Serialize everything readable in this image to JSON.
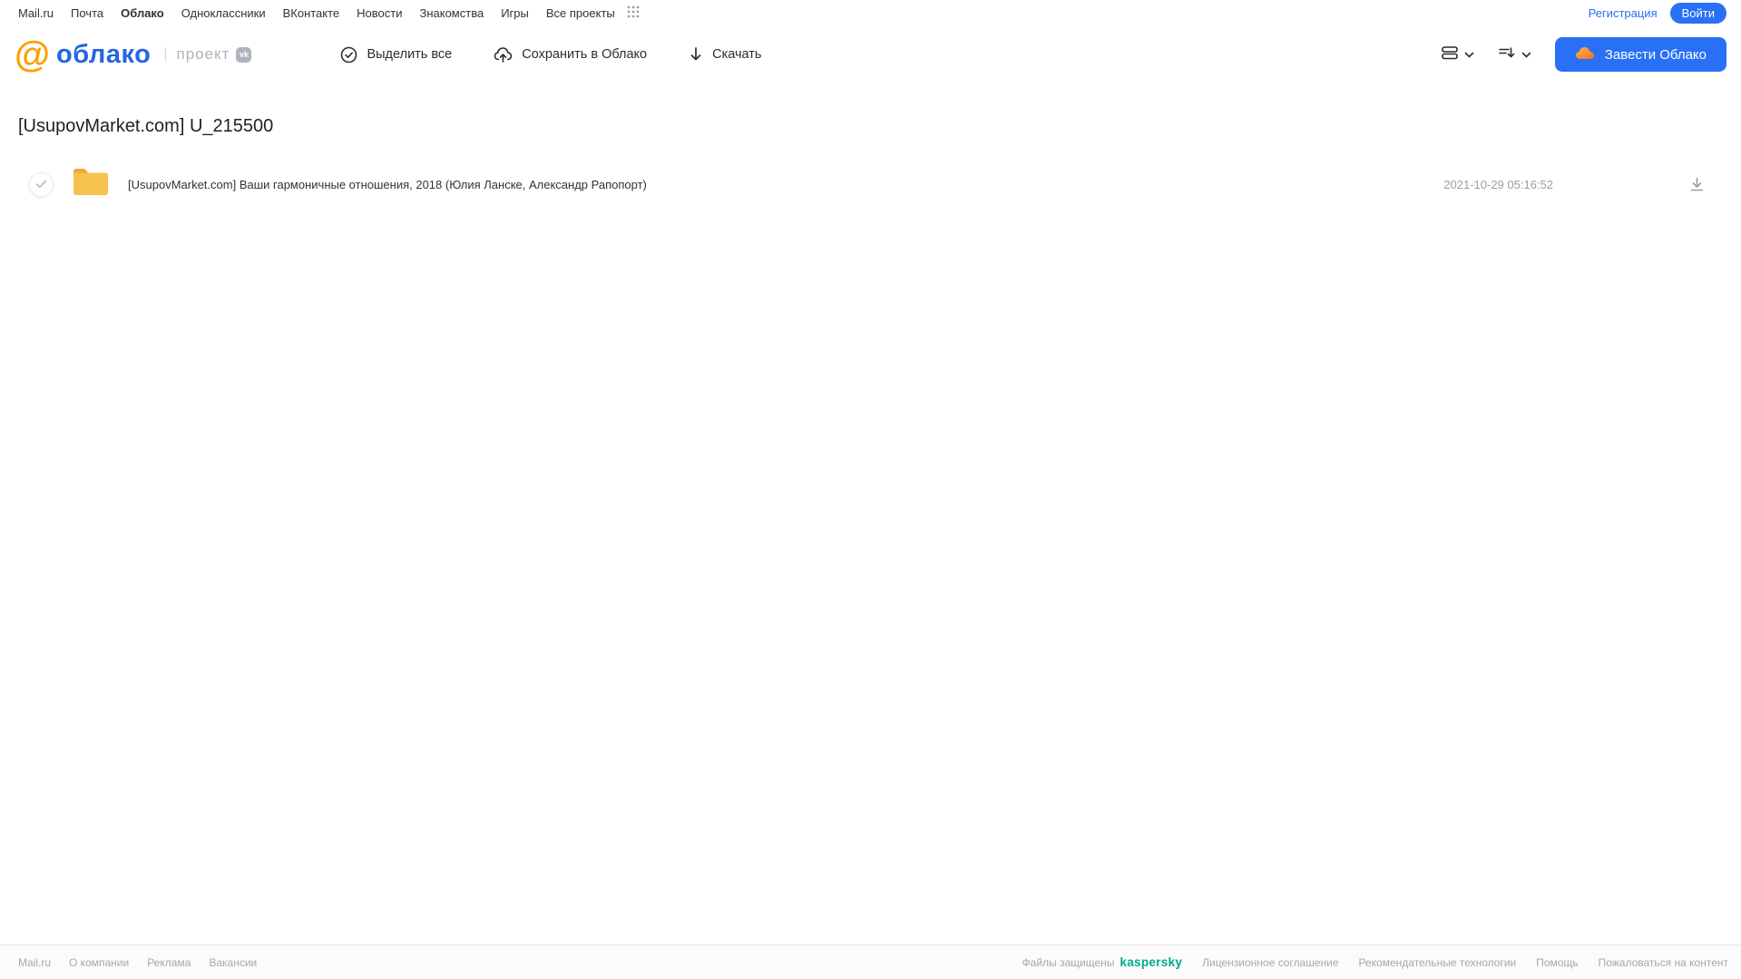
{
  "portal_nav": {
    "items": [
      {
        "label": "Mail.ru",
        "active": false
      },
      {
        "label": "Почта",
        "active": false
      },
      {
        "label": "Облако",
        "active": true
      },
      {
        "label": "Одноклассники",
        "active": false
      },
      {
        "label": "ВКонтакте",
        "active": false
      },
      {
        "label": "Новости",
        "active": false
      },
      {
        "label": "Знакомства",
        "active": false
      },
      {
        "label": "Игры",
        "active": false
      },
      {
        "label": "Все проекты",
        "active": false
      }
    ],
    "registration_label": "Регистрация",
    "login_label": "Войти"
  },
  "header": {
    "logo_text": "облако",
    "project_label": "проект",
    "vk_badge": "vk",
    "toolbar": {
      "select_all_label": "Выделить все",
      "save_to_cloud_label": "Сохранить в Облако",
      "download_label": "Скачать"
    },
    "get_cloud_label": "Завести Облако"
  },
  "main": {
    "title": "[UsupovMarket.com] U_215500",
    "files": [
      {
        "type": "folder",
        "name": "[UsupovMarket.com] Ваши гармоничные отношения, 2018 (Юлия Ланске, Александр Рапопорт)",
        "date": "2021-10-29 05:16:52"
      }
    ]
  },
  "footer": {
    "left_links": [
      "Mail.ru",
      "О компании",
      "Реклама",
      "Вакансии"
    ],
    "protected_label": "Файлы защищены",
    "kaspersky_label": "kaspersky",
    "right_links": [
      "Лицензионное соглашение",
      "Рекомендательные технологии",
      "Помощь",
      "Пожаловаться на контент"
    ]
  },
  "colors": {
    "accent_blue": "#2970f6",
    "logo_blue": "#2465e0",
    "logo_orange": "#ff9e00",
    "folder_yellow": "#f7c34e",
    "folder_tab": "#eca940",
    "kaspersky_green": "#00a88e"
  }
}
